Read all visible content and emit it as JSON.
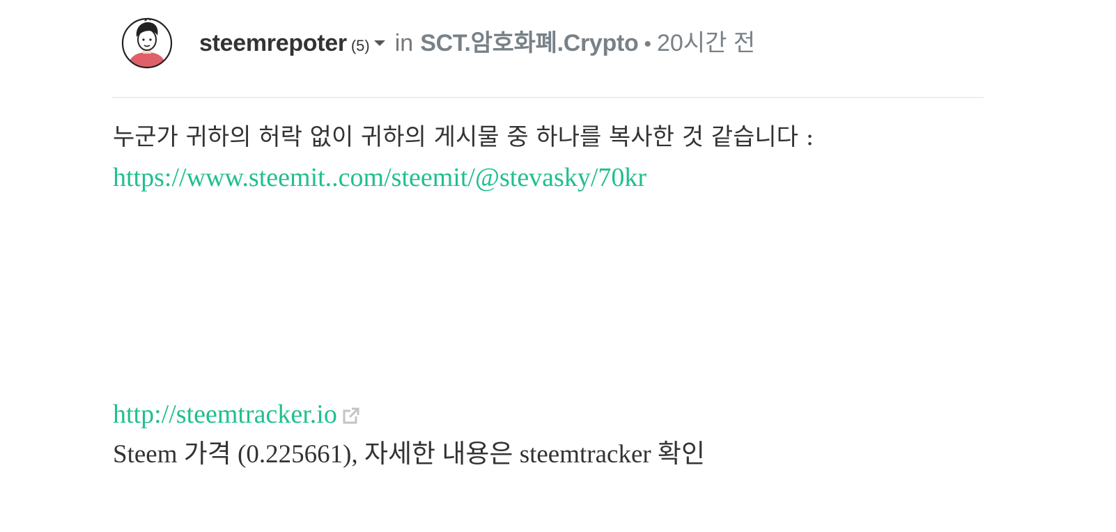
{
  "post": {
    "author": "steemrepoter",
    "reputation": "(5)",
    "in_word": "in",
    "category": "SCT.암호화폐.Crypto",
    "separator": "•",
    "time": "20시간 전"
  },
  "content": {
    "notice": "누군가 귀하의 허락 없이 귀하의 게시물 중 하나를 복사한 것 같습니다 :",
    "copied_link": "https://www.steemit..com/steemit/@stevasky/70kr",
    "tracker_link": "http://steemtracker.io",
    "price_line": "Steem 가격 (0.225661), 자세한 내용은 steemtracker 확인"
  },
  "icons": {
    "avatar": "avatar-icon",
    "dropdown": "chevron-down-icon",
    "external": "external-link-icon"
  },
  "colors": {
    "link": "#1fbf8f",
    "text": "#333333",
    "muted": "#788187"
  }
}
